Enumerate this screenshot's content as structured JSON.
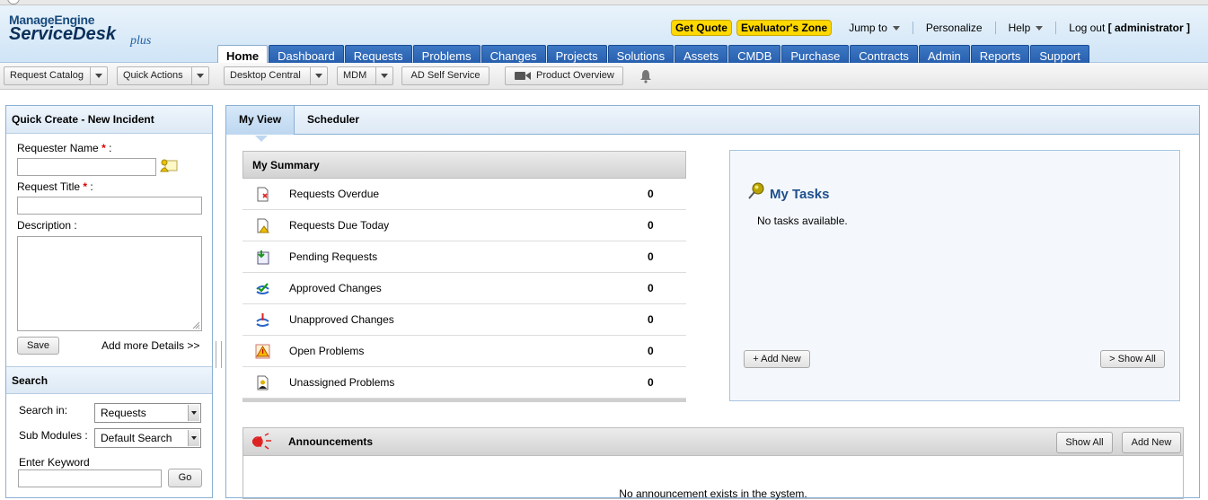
{
  "header": {
    "brand_top": "ManageEngine",
    "brand_main": "ServiceDesk",
    "brand_plus": "plus",
    "get_quote": "Get Quote",
    "evaluators_zone": "Evaluator's Zone",
    "jump_to": "Jump to",
    "personalize": "Personalize",
    "help": "Help",
    "logout_prefix": "Log out",
    "logout_user": "[ administrator ]"
  },
  "nav_tabs": [
    "Home",
    "Dashboard",
    "Requests",
    "Problems",
    "Changes",
    "Projects",
    "Solutions",
    "Assets",
    "CMDB",
    "Purchase",
    "Contracts",
    "Admin",
    "Reports",
    "Support"
  ],
  "toolbar": {
    "request_catalog": "Request Catalog",
    "quick_actions": "Quick Actions",
    "desktop_central": "Desktop Central",
    "mdm": "MDM",
    "ad_self_service": "AD Self Service",
    "product_overview": "Product Overview"
  },
  "quick_create": {
    "title": "Quick Create - New Incident",
    "requester_label": "Requester Name",
    "title_label": "Request Title",
    "description_label": "Description :",
    "required_mark": "*",
    "colon": ":",
    "save": "Save",
    "add_more": "Add more Details >>"
  },
  "search": {
    "title": "Search",
    "search_in_label": "Search in:",
    "search_in_value": "Requests",
    "sub_modules_label": "Sub Modules :",
    "sub_modules_value": "Default Search",
    "keyword_label": "Enter Keyword",
    "go": "Go"
  },
  "main_tabs": {
    "my_view": "My View",
    "scheduler": "Scheduler"
  },
  "summary": {
    "title": "My Summary",
    "rows": [
      {
        "label": "Requests Overdue",
        "count": "0",
        "icon": "overdue-icon"
      },
      {
        "label": "Requests Due Today",
        "count": "0",
        "icon": "due-today-icon"
      },
      {
        "label": "Pending Requests",
        "count": "0",
        "icon": "pending-icon"
      },
      {
        "label": "Approved Changes",
        "count": "0",
        "icon": "approved-icon"
      },
      {
        "label": "Unapproved Changes",
        "count": "0",
        "icon": "unapproved-icon"
      },
      {
        "label": "Open Problems",
        "count": "0",
        "icon": "warning-icon"
      },
      {
        "label": "Unassigned Problems",
        "count": "0",
        "icon": "unassigned-icon"
      }
    ]
  },
  "tasks": {
    "title": "My Tasks",
    "empty": "No tasks available.",
    "add_new": "+ Add New",
    "show_all": "> Show All"
  },
  "announcements": {
    "title": "Announcements",
    "show_all": "Show All",
    "add_new": "Add New",
    "empty": "No announcement exists in the system."
  },
  "colors": {
    "nav_blue": "#2259a9",
    "brand_yellow": "#ffd800",
    "header_bg": "#dbeaf7"
  }
}
